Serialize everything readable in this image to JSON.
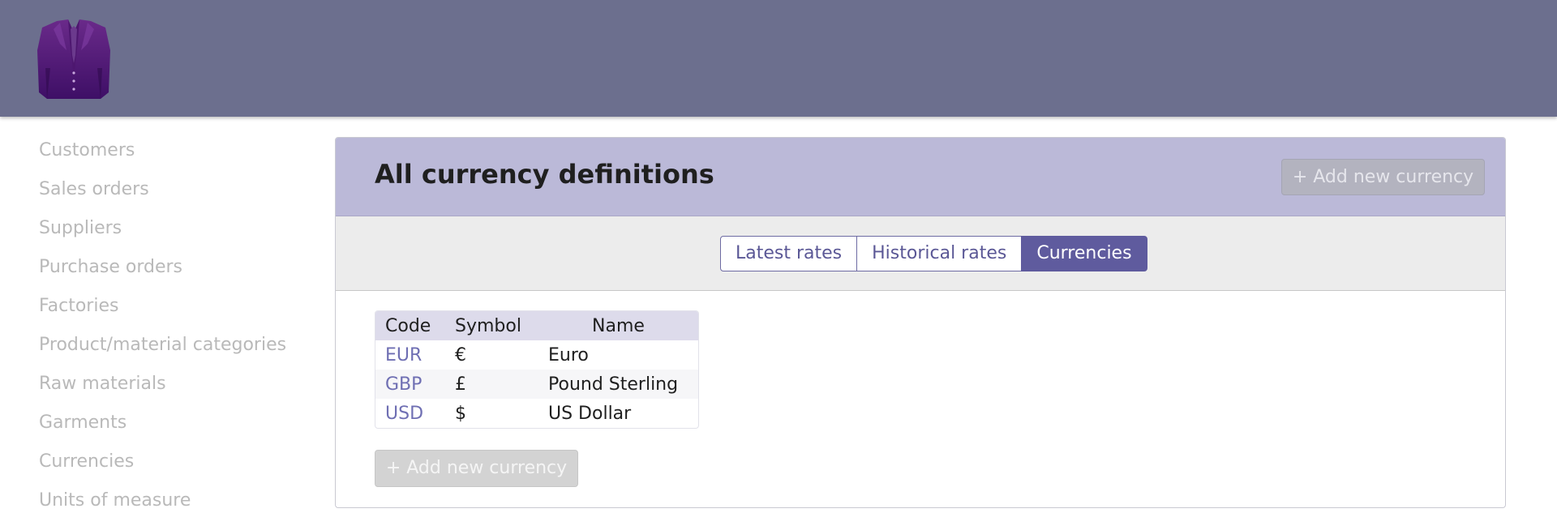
{
  "brand": {
    "logo_icon": "suit-jacket-logo-icon"
  },
  "sidebar": {
    "items": [
      {
        "label": "Customers"
      },
      {
        "label": "Sales orders"
      },
      {
        "label": "Suppliers"
      },
      {
        "label": "Purchase orders"
      },
      {
        "label": "Factories"
      },
      {
        "label": "Product/material categories"
      },
      {
        "label": "Raw materials"
      },
      {
        "label": "Garments"
      },
      {
        "label": "Currencies"
      },
      {
        "label": "Units of measure"
      }
    ]
  },
  "panel": {
    "title": "All currency definitions",
    "add_button_label": "+ Add new currency"
  },
  "tabs": [
    {
      "label": "Latest rates",
      "active": false
    },
    {
      "label": "Historical rates",
      "active": false
    },
    {
      "label": "Currencies",
      "active": true
    }
  ],
  "table": {
    "headers": {
      "code": "Code",
      "symbol": "Symbol",
      "name": "Name"
    },
    "rows": [
      {
        "code": "EUR",
        "symbol": "€",
        "name": "Euro"
      },
      {
        "code": "GBP",
        "symbol": "£",
        "name": "Pound Sterling"
      },
      {
        "code": "USD",
        "symbol": "$",
        "name": "US Dollar"
      }
    ]
  },
  "footer_add_button_label": "+ Add new currency",
  "colors": {
    "header_bar": "#6c6f8e",
    "panel_header": "#bbb9d8",
    "active_tab": "#5f5b9e",
    "link": "#6f6fb3"
  }
}
